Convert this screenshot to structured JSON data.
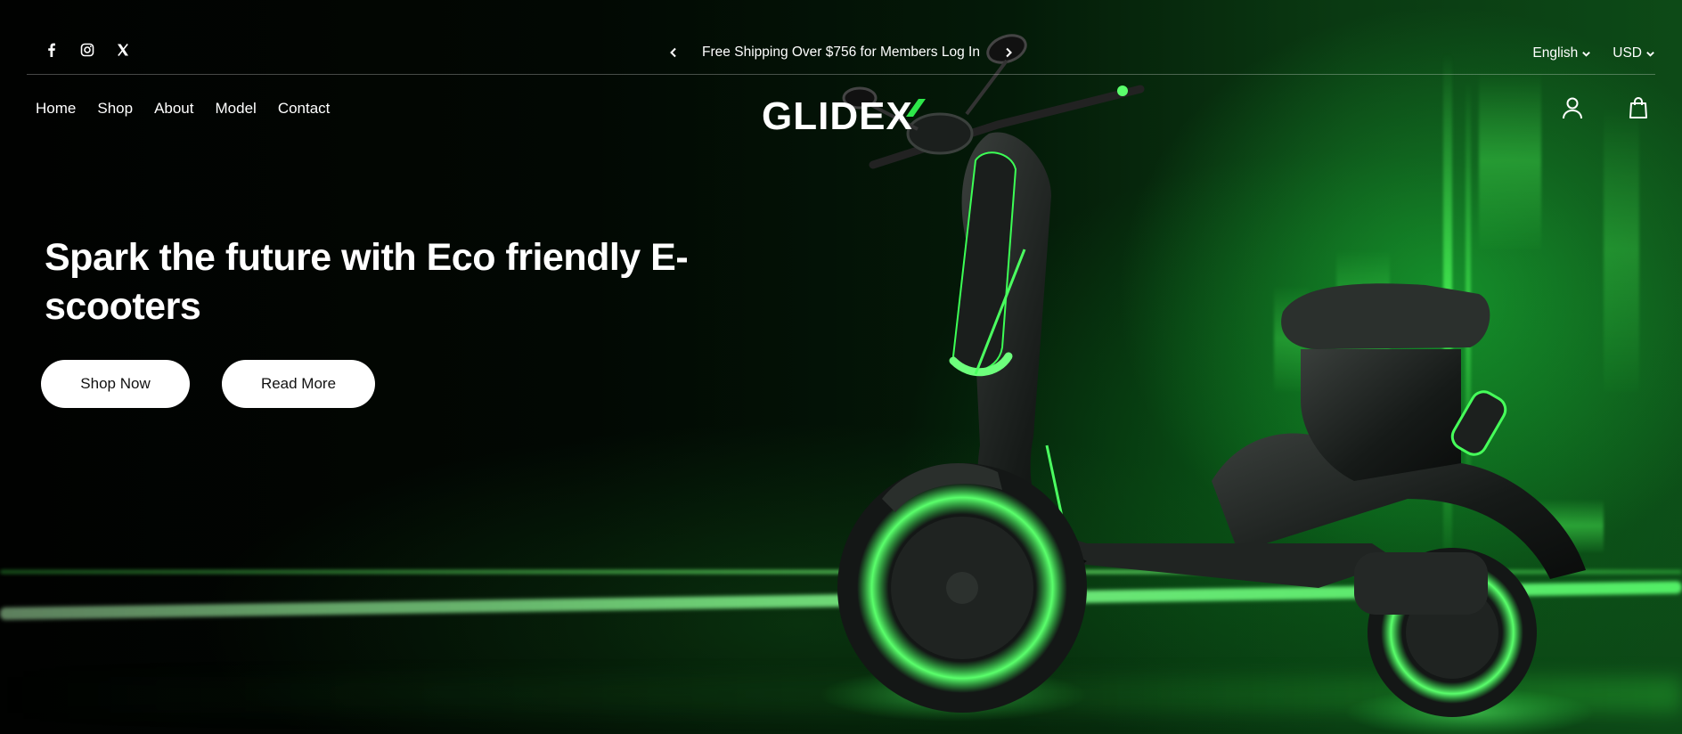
{
  "announcement": {
    "text": "Free Shipping Over $756 for Members Log In",
    "prev_icon": "chevron-left-icon",
    "next_icon": "chevron-right-icon"
  },
  "socials": [
    "facebook-icon",
    "instagram-icon",
    "x-twitter-icon"
  ],
  "locale": {
    "language": "English",
    "currency": "USD"
  },
  "nav": {
    "items": [
      "Home",
      "Shop",
      "About",
      "Model",
      "Contact"
    ]
  },
  "brand": {
    "logo_text": "GLIDEX",
    "accent": "#2ee84a"
  },
  "header_actions": [
    "account-icon",
    "cart-bag-icon"
  ],
  "hero": {
    "headline": "Spark the future with Eco friendly E-scooters",
    "primary_button": "Shop Now",
    "secondary_button": "Read More"
  },
  "colors": {
    "background": "#000000",
    "glow": "#2ee84a",
    "button_bg": "#ffffff",
    "button_text": "#111111"
  }
}
